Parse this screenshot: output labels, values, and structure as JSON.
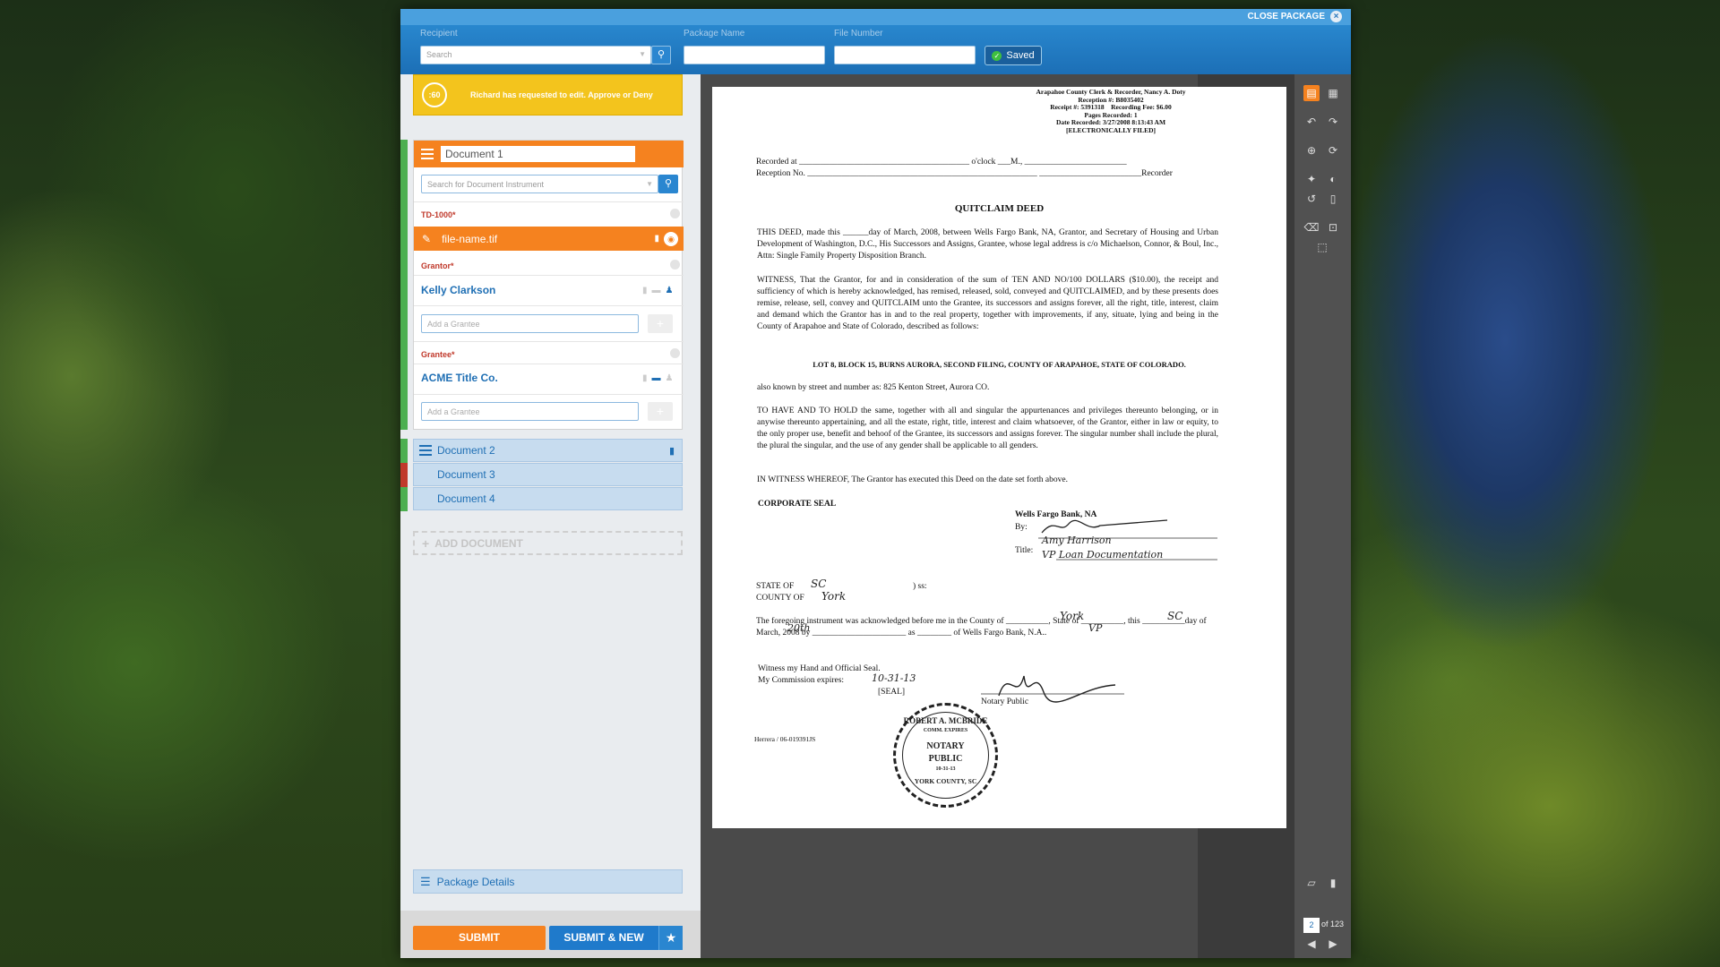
{
  "header": {
    "close_label": "CLOSE PACKAGE",
    "recipient_label": "Recipient",
    "recipient_placeholder": "Search",
    "package_label": "Package Name",
    "file_label": "File Number",
    "saved_label": "Saved"
  },
  "notification": {
    "timer": ":60",
    "text": "Richard has requested to edit. Approve or Deny"
  },
  "document1": {
    "name": "Document 1",
    "search_placeholder": "Search for Document Instrument",
    "td_label": "TD-1000*",
    "file_name": "file-name.tif",
    "grantor_label": "Grantor*",
    "grantor_name": "Kelly Clarkson",
    "add_grantee_placeholder": "Add a Grantee",
    "grantee_label": "Grantee*",
    "grantee_name": "ACME Title Co.",
    "add_grantee_placeholder2": "Add a Grantee"
  },
  "documents": [
    {
      "name": "Document 2",
      "status_color": "#4caf50"
    },
    {
      "name": "Document 3",
      "status_color": "#c0392b"
    },
    {
      "name": "Document 4",
      "status_color": "#4caf50"
    }
  ],
  "add_document": "ADD DOCUMENT",
  "package_details": "Package Details",
  "buttons": {
    "submit": "SUBMIT",
    "submit_new": "SUBMIT & NEW"
  },
  "pager": {
    "current": "2",
    "of": "of 123"
  },
  "deed": {
    "stamp": [
      "Arapahoe County Clerk & Recorder, Nancy A. Doty",
      "Reception #: B8035402",
      "Receipt #: 5391318",
      "Recording Fee: $6.00",
      "Pages Recorded: 1",
      "Date Recorded: 3/27/2008 8:13:43 AM",
      "[ELECTRONICALLY FILED]"
    ],
    "recorded_at": "Recorded at ________________________________________ o'clock ___M., ________________________",
    "reception_no": "Reception No. ______________________________________________________ ________________________Recorder",
    "title": "QUITCLAIM DEED",
    "p1": "THIS DEED, made this ______day of March, 2008, between Wells Fargo Bank, NA, Grantor, and Secretary of Housing and Urban Development of Washington, D.C., His Successors and Assigns, Grantee, whose legal address is c/o Michaelson, Connor, & Boul, Inc., Attn: Single Family Property Disposition Branch.",
    "p2": "WITNESS, That the Grantor, for and in consideration of the sum of TEN AND NO/100 DOLLARS ($10.00), the receipt and sufficiency of which is hereby acknowledged, has remised, released, sold, conveyed and QUITCLAIMED, and by these presents does remise, release, sell, convey and QUITCLAIM unto the Grantee, its successors and assigns forever, all the right, title, interest, claim and demand which the Grantor has in and to the real property, together with improvements, if any, situate, lying and being in the County of Arapahoe and State of Colorado, described as follows:",
    "legal": "LOT 8, BLOCK 15, BURNS AURORA, SECOND FILING, COUNTY OF ARAPAHOE, STATE OF COLORADO.",
    "aka": "also known by street and number as: 825 Kenton Street, Aurora CO.",
    "p3": "TO HAVE AND TO HOLD the same, together with all and singular the appurtenances and privileges thereunto belonging, or in anywise thereunto appertaining, and all the estate, right, title, interest and claim whatsoever, of the Grantor, either in law or equity, to the only proper use, benefit and behoof of the Grantee, its successors and assigns forever. The singular number shall include the plural, the plural the singular, and the use of any gender shall be applicable to all genders.",
    "p4": "IN WITNESS WHEREOF, The Grantor has executed this Deed on the date set forth above.",
    "corp_seal": "CORPORATE SEAL",
    "bank": "Wells Fargo Bank, NA",
    "by": "By:",
    "title_label": "Title:",
    "state_of": "STATE OF",
    "county_of": "COUNTY OF",
    "ss": ") ss:",
    "ack": "The foregoing instrument was acknowledged before me in the County of __________, State of __________, this __________day of March, 2008 by ______________________ as ________ of Wells Fargo Bank, N.A..",
    "witness": "Witness my Hand and Official Seal.",
    "commission": "My Commission expires:",
    "seal": "[SEAL]",
    "notary": "Notary Public",
    "footer": "Herrera / 06-019391JS",
    "hw_state": "SC",
    "hw_county": "York",
    "hw_county2": "York",
    "hw_state2": "SC",
    "hw_day": "20th",
    "hw_name": "Amy Harrison",
    "hw_as": "VP",
    "hw_exp": "10-31-13",
    "hw_title": "VP Loan Documentation",
    "notary_seal": [
      "ROBERT A. MCBRIDE",
      "NOTARY",
      "PUBLIC",
      "YORK COUNTY, SC",
      "COMM. EXPIRES",
      "10-31-13"
    ]
  }
}
